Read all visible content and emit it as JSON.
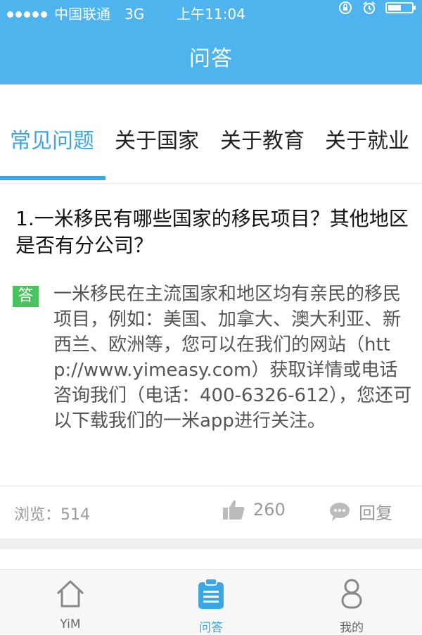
{
  "status_bar": {
    "carrier": "中国联通",
    "network": "3G",
    "time": "上午11:04"
  },
  "nav": {
    "title": "问答"
  },
  "tabs": [
    {
      "label": "常见问题",
      "active": true
    },
    {
      "label": "关于国家",
      "active": false
    },
    {
      "label": "关于教育",
      "active": false
    },
    {
      "label": "关于就业",
      "active": false
    }
  ],
  "qa": {
    "question": "1.一米移民有哪些国家的移民项目？其他地区是否有分公司？",
    "answer_badge": "答",
    "answer": "一米移民在主流国家和地区均有亲民的移民项目，例如：美国、加拿大、澳大利亚、新西兰、欧洲等，您可以在我们的网站（http://www.yimeasy.com）获取详情或电话咨询我们（电话：400-6326-612），您还可以下载我们的一米app进行关注。",
    "views_label": "浏览：514",
    "likes": "260",
    "reply_label": "回复"
  },
  "bottom_tabs": [
    {
      "label": "YiM",
      "icon": "home-icon",
      "active": false
    },
    {
      "label": "问答",
      "icon": "clipboard-icon",
      "active": true
    },
    {
      "label": "我的",
      "icon": "person-icon",
      "active": false
    }
  ],
  "colors": {
    "header_blue": "#4fb3ee",
    "accent_blue": "#3aa6e3",
    "answer_green": "#49c35e"
  }
}
